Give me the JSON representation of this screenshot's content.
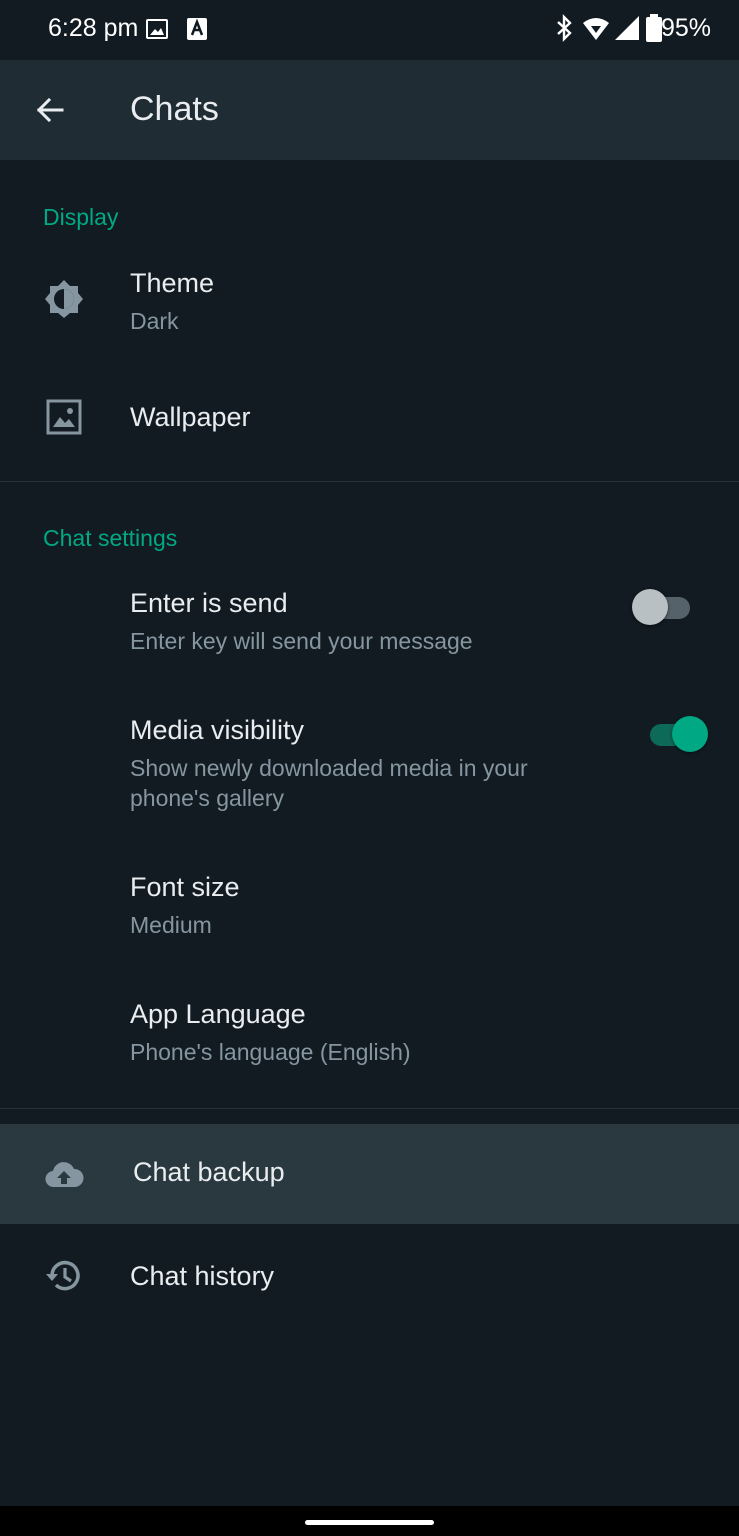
{
  "status_bar": {
    "time": "6:28 pm",
    "battery": "95%"
  },
  "app_bar": {
    "title": "Chats"
  },
  "sections": {
    "display": {
      "header": "Display",
      "theme": {
        "title": "Theme",
        "subtitle": "Dark"
      },
      "wallpaper": {
        "title": "Wallpaper"
      }
    },
    "chat_settings": {
      "header": "Chat settings",
      "enter_is_send": {
        "title": "Enter is send",
        "subtitle": "Enter key will send your message",
        "enabled": false
      },
      "media_visibility": {
        "title": "Media visibility",
        "subtitle": "Show newly downloaded media in your phone's gallery",
        "enabled": true
      },
      "font_size": {
        "title": "Font size",
        "subtitle": "Medium"
      },
      "app_language": {
        "title": "App Language",
        "subtitle": "Phone's language (English)"
      }
    },
    "other": {
      "chat_backup": {
        "title": "Chat backup"
      },
      "chat_history": {
        "title": "Chat history"
      }
    }
  },
  "colors": {
    "background": "#121b22",
    "app_bar": "#1f2c34",
    "accent": "#00a884",
    "primary_text": "#e9edef",
    "secondary_text": "#8696a0"
  },
  "icons": [
    "image-icon",
    "a-badge-icon",
    "bluetooth-icon",
    "wifi-icon",
    "signal-icon",
    "battery-icon",
    "back-arrow-icon",
    "theme-brightness-icon",
    "wallpaper-icon",
    "cloud-upload-icon",
    "history-icon"
  ]
}
